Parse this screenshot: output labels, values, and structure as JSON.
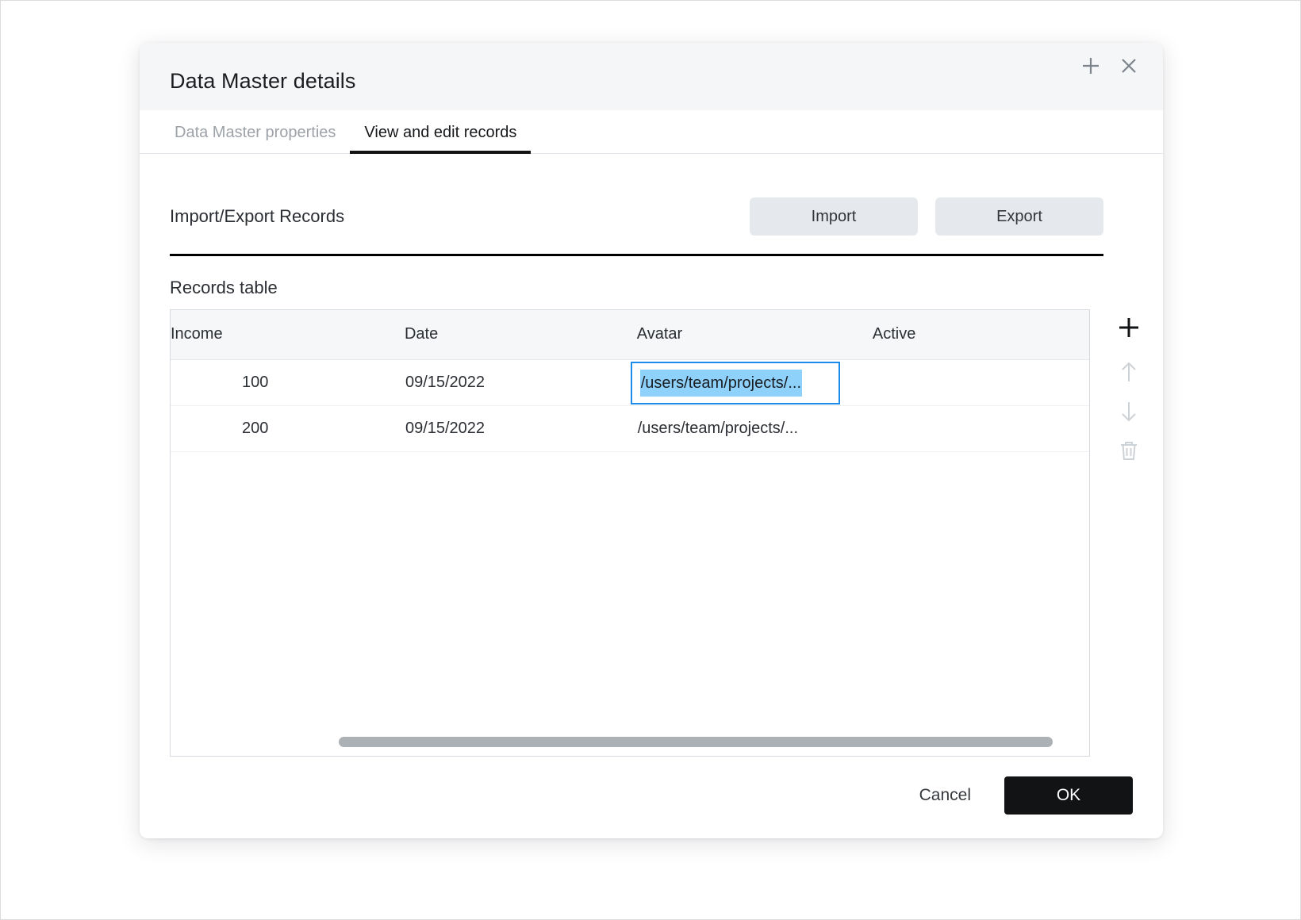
{
  "dialog": {
    "title": "Data Master details",
    "header_icons": [
      {
        "name": "add-icon",
        "label": "+"
      },
      {
        "name": "close-icon",
        "label": "×"
      }
    ],
    "tabs": [
      {
        "label": "Data Master properties",
        "active": false
      },
      {
        "label": "View and edit records",
        "active": true
      }
    ]
  },
  "import_export": {
    "label": "Import/Export Records",
    "import_label": "Import",
    "export_label": "Export"
  },
  "records": {
    "section_label": "Records table",
    "columns": [
      "Income",
      "Date",
      "Avatar",
      "Active"
    ],
    "rows": [
      {
        "income": "100",
        "date": "09/15/2022",
        "avatar": "/users/team/projects/...",
        "active": ""
      },
      {
        "income": "200",
        "date": "09/15/2022",
        "avatar": "/users/team/projects/...",
        "active": ""
      }
    ],
    "selected_cell": {
      "row": 0,
      "column": "Avatar",
      "value": "/users/team/projects/...",
      "border_color": "#1b8ceb",
      "selection_color": "#8ed1fb"
    },
    "scrollbar": {
      "orientation": "horizontal",
      "thumb_color": "#abb1b5"
    }
  },
  "side_tools": [
    {
      "name": "add-row-icon",
      "enabled": true
    },
    {
      "name": "move-up-icon",
      "enabled": false
    },
    {
      "name": "move-down-icon",
      "enabled": false
    },
    {
      "name": "delete-row-icon",
      "enabled": false
    }
  ],
  "footer": {
    "cancel_label": "Cancel",
    "ok_label": "OK"
  },
  "colors": {
    "header_bg": "#f4f6f8",
    "accent_black": "#111315",
    "button_gray": "#e5e9ed",
    "selection_blue": "#8ed1fb",
    "focus_blue": "#1b8ceb"
  }
}
